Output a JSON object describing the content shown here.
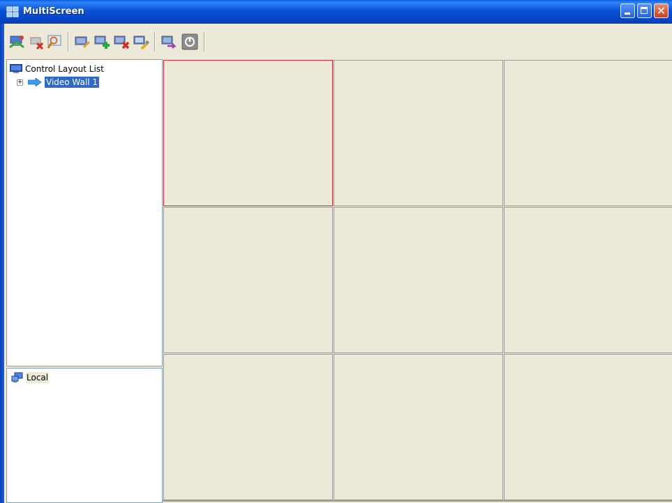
{
  "window": {
    "title": "MultiScreen",
    "icon": "monitor-wall-icon",
    "controls": [
      "minimize-icon",
      "maximize-icon",
      "close-icon"
    ]
  },
  "toolbar": {
    "items": [
      {
        "name": "connect-icon"
      },
      {
        "name": "disconnect-icon"
      },
      {
        "name": "search-device-icon"
      },
      {
        "name": "edit-layout-icon"
      },
      {
        "name": "add-layout-icon"
      },
      {
        "name": "delete-layout-icon"
      },
      {
        "name": "layout-settings-icon"
      },
      {
        "name": "switch-layout-icon"
      },
      {
        "name": "power-icon"
      }
    ]
  },
  "tree": {
    "root_label": "Control Layout List",
    "children": [
      {
        "label": "Video Wall 1",
        "selected": true,
        "expander": "+"
      }
    ]
  },
  "local_pane": {
    "items": [
      {
        "label": "Local"
      }
    ]
  },
  "video_wall": {
    "rows": 3,
    "cols": 3,
    "active_cell": 0,
    "active_border_color": "#d9232a"
  },
  "colors": {
    "titlebar": "#0a52d8",
    "face": "#ece9d8",
    "selection": "#316ac5"
  }
}
